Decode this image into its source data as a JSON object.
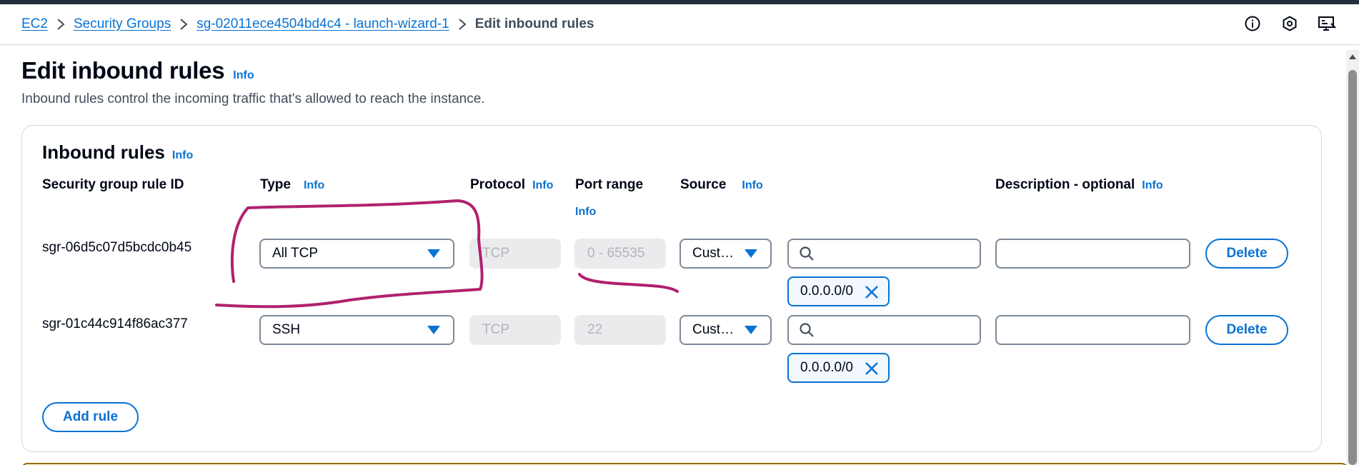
{
  "breadcrumbs": {
    "items": [
      "EC2",
      "Security Groups",
      "sg-02011ece4504bd4c4 - launch-wizard-1"
    ],
    "current": "Edit inbound rules"
  },
  "header_icons": [
    "info-circle-icon",
    "feedback-hexagon-icon",
    "screen-share-icon"
  ],
  "page": {
    "title": "Edit inbound rules",
    "info": "Info",
    "description": "Inbound rules control the incoming traffic that's allowed to reach the instance."
  },
  "inbound": {
    "title": "Inbound rules",
    "info": "Info",
    "columns": {
      "rule_id": "Security group rule ID",
      "type": "Type",
      "type_info": "Info",
      "protocol": "Protocol",
      "protocol_info": "Info",
      "port_range": "Port range",
      "port_range_info": "Info",
      "source": "Source",
      "source_info": "Info",
      "description": "Description - optional",
      "description_info": "Info"
    },
    "rules": [
      {
        "id": "sgr-06d5c07d5bcdc0b45",
        "type": "All TCP",
        "protocol": "TCP",
        "port_range": "0 - 65535",
        "source": "Cust…",
        "search_value": "",
        "cidr_token": "0.0.0.0/0",
        "description": "",
        "delete_label": "Delete"
      },
      {
        "id": "sgr-01c44c914f86ac377",
        "type": "SSH",
        "protocol": "TCP",
        "port_range": "22",
        "source": "Cust…",
        "search_value": "",
        "cidr_token": "0.0.0.0/0",
        "description": "",
        "delete_label": "Delete"
      }
    ],
    "add_rule_label": "Add rule"
  },
  "colors": {
    "link": "#0972d3",
    "text": "#000716",
    "annotation": "#b0216e",
    "disabled_bg": "#e9ebed",
    "disabled_text": "#b4b4bb"
  }
}
